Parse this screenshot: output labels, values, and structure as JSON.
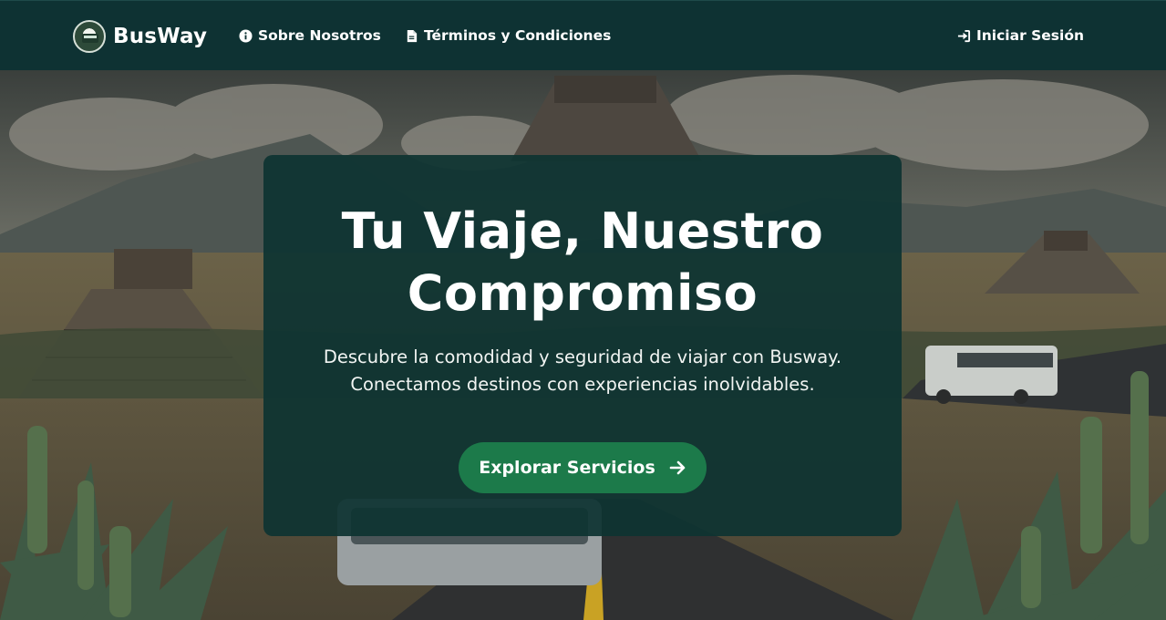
{
  "navbar": {
    "brand": "BusWay",
    "links": {
      "about": "Sobre Nosotros",
      "terms": "Términos y Condiciones",
      "login": "Iniciar Sesión"
    }
  },
  "hero": {
    "title": "Tu Viaje, Nuestro Compromiso",
    "description_line1": "Descubre la comodidad y seguridad de viajar con Busway.",
    "description_line2": "Conectamos destinos con experiencias inolvidables.",
    "cta_label": "Explorar Servicios"
  },
  "colors": {
    "navbar": "#0e3233",
    "card": "#0e3432",
    "cta": "#1c7a4a",
    "text": "#ffffff"
  },
  "icons": {
    "brand": "bus-logo-icon",
    "about": "info-circle-icon",
    "terms": "file-text-icon",
    "login": "sign-in-icon",
    "cta": "arrow-right-icon"
  }
}
